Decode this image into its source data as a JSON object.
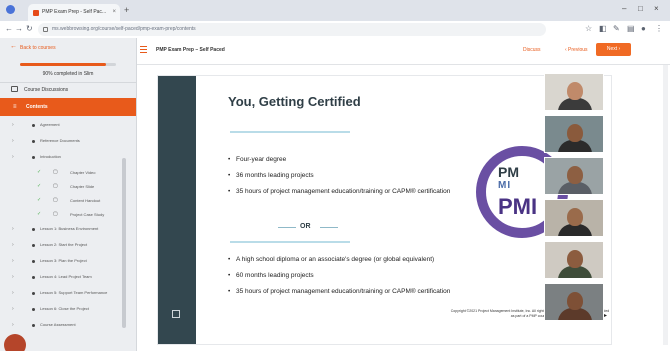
{
  "browser": {
    "tab_title": "PMP Exam Prep - Self Pac...",
    "url": "ms.webbrowsing.org/course/self-paced/pmp-exam-prep/contents",
    "minimize": "–",
    "maximize": "□",
    "close": "×",
    "new_tab": "+"
  },
  "sidebar": {
    "back_label": "Back to courses",
    "progress_percent": 90,
    "progress_text": "90% completed in Slim",
    "discussions_label": "Course Discussions",
    "contents_label": "Contents",
    "items": [
      {
        "label": "Agreement",
        "type": "section"
      },
      {
        "label": "Reference Documents",
        "type": "section"
      },
      {
        "label": "Introduction",
        "type": "section"
      },
      {
        "label": "Chapter Video",
        "type": "sub",
        "status": "✓",
        "kind": "▢"
      },
      {
        "label": "Chapter Slide",
        "type": "sub",
        "status": "✓",
        "kind": "▢"
      },
      {
        "label": "Content Handout",
        "type": "sub",
        "status": "✓",
        "kind": "▢"
      },
      {
        "label": "Project Case Study",
        "type": "sub",
        "status": "✓",
        "kind": "▢"
      },
      {
        "label": "Lesson 1: Business Environment",
        "type": "section"
      },
      {
        "label": "Lesson 2: Start the Project",
        "type": "section"
      },
      {
        "label": "Lesson 3: Plan the Project",
        "type": "section"
      },
      {
        "label": "Lesson 4: Lead Project Team",
        "type": "section"
      },
      {
        "label": "Lesson 5: Support Team Performance",
        "type": "section"
      },
      {
        "label": "Lesson 6: Close the Project",
        "type": "section"
      },
      {
        "label": "Course Assessment",
        "type": "section"
      }
    ]
  },
  "header": {
    "course_title": "PMP Exam Prep – Self Paced",
    "discuss_label": "Discuss",
    "previous_label": "‹ Previous",
    "next_label": "Next ›"
  },
  "slide": {
    "title": "You, Getting Certified",
    "group1": [
      "Four-year degree",
      "36 months leading projects",
      "35 hours of project management education/training or CAPM® certification"
    ],
    "or_text": "OR",
    "group2": [
      "A high school diploma or an associate's degree (or global equivalent)",
      "60 months leading projects",
      "35 hours of project management education/training or CAPM® certification"
    ],
    "logo_pm": "PM",
    "logo_mid": "MI",
    "logo_big": "PMI",
    "copyright": "Copyright ©2021 Project Management Institute, Inc. All rights reserved. This material is being provided as part of a PMP course.",
    "nav_dot": "▸"
  },
  "video_tiles": [
    {
      "bg": "#d9d6cf",
      "skin": "#c08a6a",
      "shirt": "#3b3b3b"
    },
    {
      "bg": "#7a8a8e",
      "skin": "#8a5a3c",
      "shirt": "#2b2b2b"
    },
    {
      "bg": "#9aa3a5",
      "skin": "#8d5f42",
      "shirt": "#5a5f66"
    },
    {
      "bg": "#b9b3a8",
      "skin": "#9a6b4b",
      "shirt": "#2a2a2a"
    },
    {
      "bg": "#cfcac2",
      "skin": "#8c5c3f",
      "shirt": "#3f4d3a"
    },
    {
      "bg": "#7b8082",
      "skin": "#7e5036",
      "shirt": "#5c3a2a"
    }
  ],
  "colors": {
    "accent": "#e85a1b",
    "slide_dark": "#33474f",
    "pmi_purple": "#6a4fa3"
  }
}
